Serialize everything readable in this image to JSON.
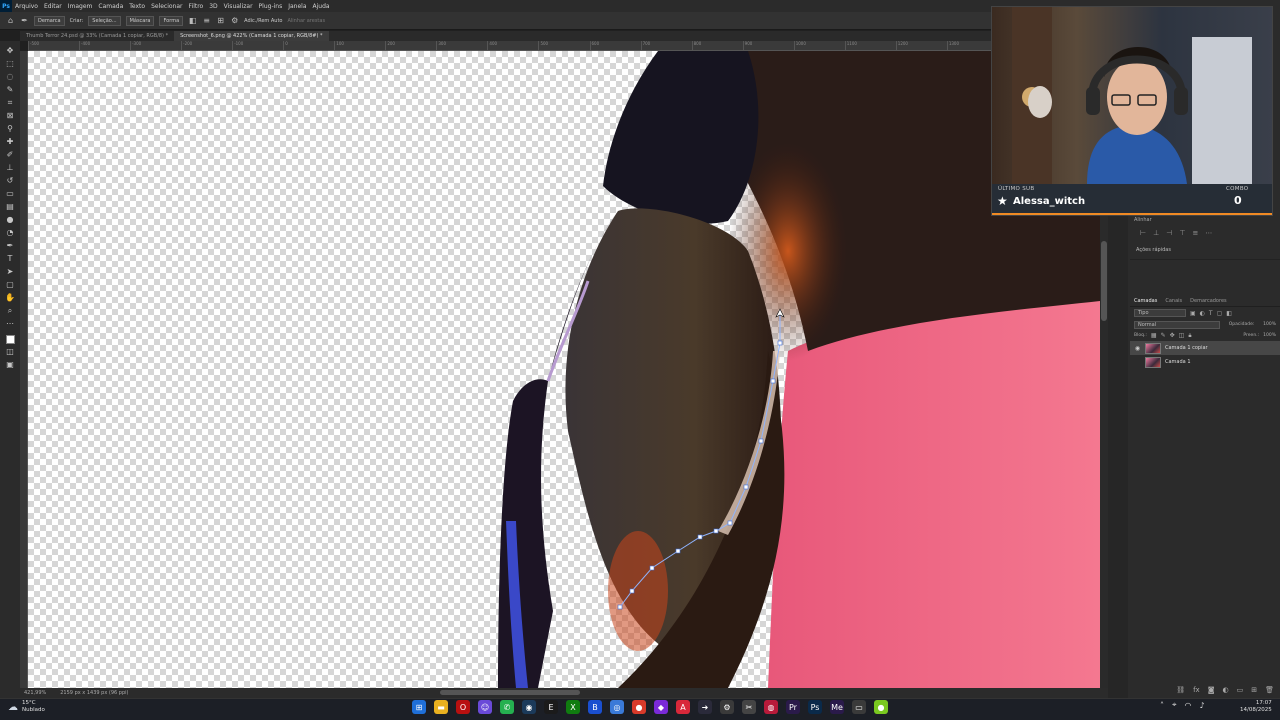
{
  "app": {
    "logo": "Ps",
    "menus": [
      "Arquivo",
      "Editar",
      "Imagem",
      "Camada",
      "Texto",
      "Selecionar",
      "Filtro",
      "3D",
      "Visualizar",
      "Plug-ins",
      "Janela",
      "Ajuda"
    ]
  },
  "options_bar": {
    "mode": "Demarca",
    "criar": "Criar:",
    "selecao": "Seleção...",
    "mascara": "Máscara",
    "forma": "Forma",
    "auto_add": "Adic./Rem Auto",
    "align_edges": "Alinhar arestas"
  },
  "tabs": [
    {
      "label": "Thumb Terror 24.psd @ 33% (Camada 1 copiar, RGB/8) *",
      "active": false
    },
    {
      "label": "Screenshot_6.png @ 422% (Camada 1 copiar, RGB/8#) *",
      "active": true
    }
  ],
  "ruler_marks": [
    "-500",
    "-400",
    "-300",
    "-200",
    "-100",
    "0",
    "100",
    "200",
    "300",
    "400",
    "500",
    "600",
    "700",
    "800",
    "900",
    "1000",
    "1100",
    "1200",
    "1300",
    "1400",
    "1500"
  ],
  "status": {
    "zoom": "421,99%",
    "doc_size": "2159 px x 1439 px (96 ppi)"
  },
  "panels": {
    "align_label": "Alinhar",
    "quick_actions": "Ações rápidas",
    "layer_tabs": [
      "Camadas",
      "Canais",
      "Demarcadores"
    ],
    "filter": "Tipo",
    "blend_mode": "Normal",
    "opacity_label": "Opacidade:",
    "opacity_value": "100%",
    "lock_label": "Bloq.:",
    "fill_label": "Preen.:",
    "fill_value": "100%",
    "layers": [
      {
        "name": "Camada 1 copiar",
        "selected": true
      },
      {
        "name": "Camada 1",
        "selected": false
      }
    ]
  },
  "webcam_overlay": {
    "left_label": "ÚLTIMO SUB",
    "name": "Alessa_witch",
    "right_label": "COMBO",
    "count": "0"
  },
  "taskbar": {
    "temperature": "15°C",
    "weather": "Nublado",
    "time": "17:07",
    "date": "14/08/2025"
  }
}
